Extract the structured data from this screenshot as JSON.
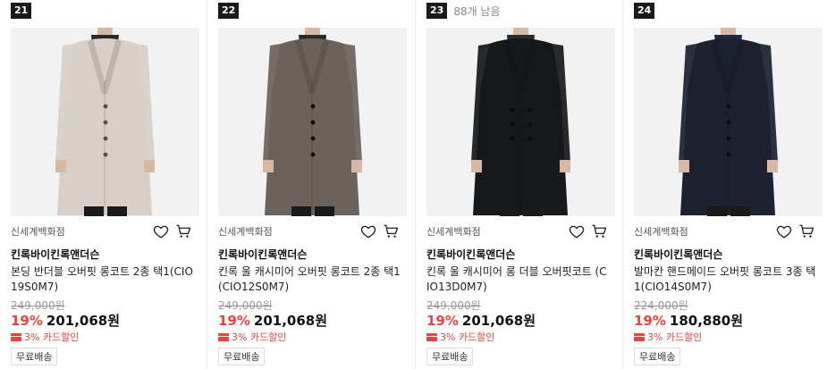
{
  "products": [
    {
      "rank": "21",
      "stock": "",
      "store": "신세계백화점",
      "brand": "킨록바이킨록앤더슨",
      "name": "본딩 반더블 오버핏 롱코트 2종 택1(CIO19S0M7)",
      "original_price": "249,000원",
      "discount": "19%",
      "price": "201,068원",
      "card_discount": "3% 카드할인",
      "shipping": "무료배송",
      "coat_color": "#d8d0c8",
      "background_color": "#f2f2f2",
      "coat_style": "single-breasted coat"
    },
    {
      "rank": "22",
      "stock": "",
      "store": "신세계백화점",
      "brand": "킨록바이킨록앤더슨",
      "name": "킨록 울 캐시미어 오버핏 롱코트 2종 택1(CIO12S0M7)",
      "original_price": "249,000원",
      "discount": "19%",
      "price": "201,068원",
      "card_discount": "3% 카드할인",
      "shipping": "무료배송",
      "coat_color": "#6b625c",
      "background_color": "#f2f2f2",
      "coat_style": "single-breasted coat"
    },
    {
      "rank": "23",
      "stock": "88개 남음",
      "store": "신세계백화점",
      "brand": "킨록바이킨록앤더슨",
      "name": "킨록 울 캐시미어 롱 더블 오버핏코트 (CIO13D0M7)",
      "original_price": "249,000원",
      "discount": "19%",
      "price": "201,068원",
      "card_discount": "3% 카드할인",
      "shipping": "무료배송",
      "coat_color": "#16181c",
      "background_color": "#f2f2f2",
      "coat_style": "double-breasted coat"
    },
    {
      "rank": "24",
      "stock": "",
      "store": "신세계백화점",
      "brand": "킨록바이킨록앤더슨",
      "name": "발마칸 핸드메이드 오버핏 롱코트 3종 택1(CIO14S0M7)",
      "original_price": "224,000원",
      "discount": "19%",
      "price": "180,880원",
      "card_discount": "3% 카드할인",
      "shipping": "무료배송",
      "coat_color": "#1c2130",
      "background_color": "#f2f2f2",
      "coat_style": "balmacaan coat"
    }
  ],
  "icons": {
    "wishlist": "heart-icon",
    "cart": "cart-icon",
    "card": "credit-card-icon"
  },
  "colors": {
    "discount": "#f0413b",
    "rank_badge": "#1a1a1a"
  }
}
